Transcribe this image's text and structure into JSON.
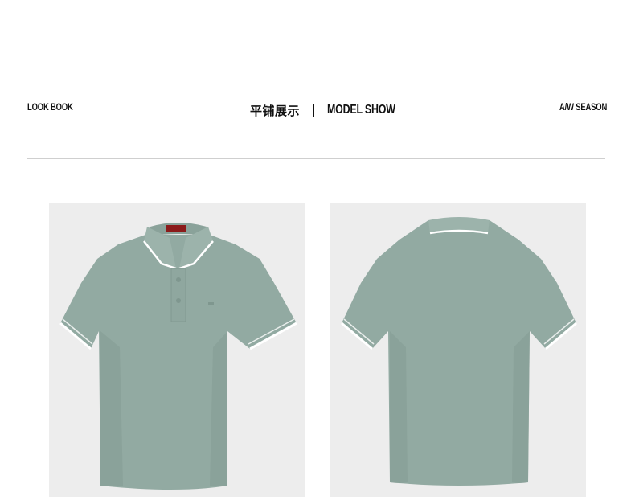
{
  "header": {
    "left_label": "LOOK BOOK",
    "center_cn": "平铺展示",
    "center_en": "MODEL SHOW",
    "right_label": "A/W SEASON"
  },
  "colors": {
    "shirt": "#92aaa2",
    "shirt_shadow": "#859d95",
    "background": "#ededed",
    "trim": "#ffffff"
  },
  "photos": [
    {
      "view": "front-view",
      "icon": "polo-shirt-front-icon"
    },
    {
      "view": "back-view",
      "icon": "polo-shirt-back-icon"
    }
  ]
}
